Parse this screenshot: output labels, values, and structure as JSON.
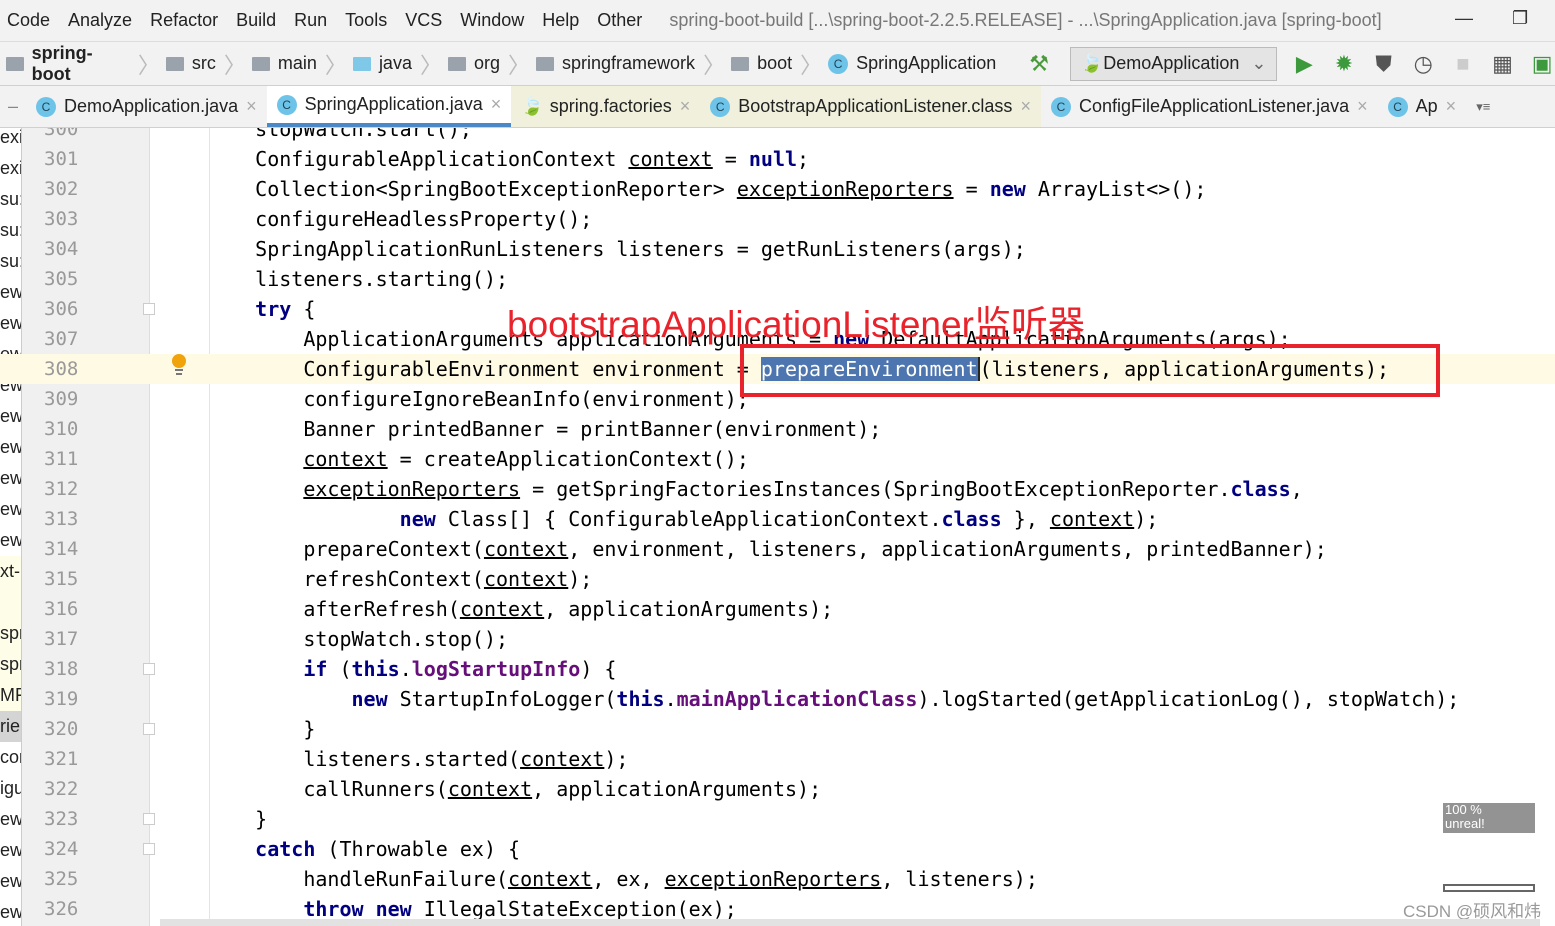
{
  "menu": [
    "Code",
    "Analyze",
    "Refactor",
    "Build",
    "Run",
    "Tools",
    "VCS",
    "Window",
    "Help",
    "Other"
  ],
  "window_title": "spring-boot-build [...\\spring-boot-2.2.5.RELEASE] - ...\\SpringApplication.java [spring-boot]",
  "window_buttons": {
    "minimize": "—",
    "restore": "❐"
  },
  "breadcrumb": [
    "spring-boot",
    "src",
    "main",
    "java",
    "org",
    "springframework",
    "boot",
    "SpringApplication"
  ],
  "run_config": "DemoApplication",
  "tabs": [
    {
      "label": "DemoApplication.java",
      "state": "normal"
    },
    {
      "label": "SpringApplication.java",
      "state": "active"
    },
    {
      "label": "spring.factories",
      "state": "yellow"
    },
    {
      "label": "BootstrapApplicationListener.class",
      "state": "yellow"
    },
    {
      "label": "ConfigFileApplicationListener.java",
      "state": "normal"
    },
    {
      "label": "Ap",
      "state": "normal"
    }
  ],
  "left_panel": [
    "exi",
    "exi",
    "su:",
    "su:",
    "su:",
    "ewo",
    "ewo",
    "ewo",
    "ewo",
    "ewo",
    "ewo",
    "ewo",
    "ewo",
    "ewo",
    "xt-",
    "",
    "spri",
    "spri",
    "MF",
    "rie",
    "cor",
    "igu",
    "ewo",
    "ewo",
    "ewo",
    "ewo",
    "ewo"
  ],
  "code": [
    {
      "n": "300",
      "t": [
        [
          "    stopWatch.start();",
          ""
        ]
      ]
    },
    {
      "n": "301",
      "t": [
        [
          "    ConfigurableApplicationContext ",
          ""
        ],
        [
          "context",
          "u"
        ],
        [
          " = ",
          ""
        ],
        [
          "null",
          "kw"
        ],
        [
          ";",
          ""
        ]
      ]
    },
    {
      "n": "302",
      "t": [
        [
          "    Collection<SpringBootExceptionReporter> ",
          ""
        ],
        [
          "exceptionReporters",
          "u"
        ],
        [
          " = ",
          ""
        ],
        [
          "new",
          "kw"
        ],
        [
          " ArrayList<>();",
          ""
        ]
      ]
    },
    {
      "n": "303",
      "t": [
        [
          "    configureHeadlessProperty();",
          ""
        ]
      ]
    },
    {
      "n": "304",
      "t": [
        [
          "    SpringApplicationRunListeners listeners = getRunListeners(args);",
          ""
        ]
      ]
    },
    {
      "n": "305",
      "t": [
        [
          "    listeners.starting();",
          ""
        ]
      ]
    },
    {
      "n": "306",
      "t": [
        [
          "    ",
          ""
        ],
        [
          "try",
          "kw"
        ],
        [
          " {",
          ""
        ]
      ]
    },
    {
      "n": "307",
      "t": [
        [
          "        ApplicationArguments applicationArguments = ",
          ""
        ],
        [
          "new",
          "kw"
        ],
        [
          " DefaultApplicationArguments(args);",
          ""
        ]
      ]
    },
    {
      "n": "308",
      "t": [
        [
          "        ConfigurableEnvironment environment = ",
          ""
        ],
        [
          "prepareEnvironment",
          "sel"
        ],
        [
          "(listeners, applicationArguments);",
          ""
        ]
      ]
    },
    {
      "n": "309",
      "t": [
        [
          "        configureIgnoreBeanInfo(environment);",
          ""
        ]
      ]
    },
    {
      "n": "310",
      "t": [
        [
          "        Banner printedBanner = printBanner(environment);",
          ""
        ]
      ]
    },
    {
      "n": "311",
      "t": [
        [
          "        ",
          ""
        ],
        [
          "context",
          "u"
        ],
        [
          " = createApplicationContext();",
          ""
        ]
      ]
    },
    {
      "n": "312",
      "t": [
        [
          "        ",
          ""
        ],
        [
          "exceptionReporters",
          "u"
        ],
        [
          " = getSpringFactoriesInstances(SpringBootExceptionReporter.",
          ""
        ],
        [
          "class",
          "kw"
        ],
        [
          ",",
          ""
        ]
      ]
    },
    {
      "n": "313",
      "t": [
        [
          "                ",
          ""
        ],
        [
          "new",
          "kw"
        ],
        [
          " Class[] { ConfigurableApplicationContext.",
          ""
        ],
        [
          "class",
          "kw"
        ],
        [
          " }, ",
          ""
        ],
        [
          "context",
          "u"
        ],
        [
          ");",
          ""
        ]
      ]
    },
    {
      "n": "314",
      "t": [
        [
          "        prepareContext(",
          ""
        ],
        [
          "context",
          "u"
        ],
        [
          ", environment, listeners, applicationArguments, printedBanner);",
          ""
        ]
      ]
    },
    {
      "n": "315",
      "t": [
        [
          "        refreshContext(",
          ""
        ],
        [
          "context",
          "u"
        ],
        [
          ");",
          ""
        ]
      ]
    },
    {
      "n": "316",
      "t": [
        [
          "        afterRefresh(",
          ""
        ],
        [
          "context",
          "u"
        ],
        [
          ", applicationArguments);",
          ""
        ]
      ]
    },
    {
      "n": "317",
      "t": [
        [
          "        stopWatch.stop();",
          ""
        ]
      ]
    },
    {
      "n": "318",
      "t": [
        [
          "        ",
          ""
        ],
        [
          "if",
          "kw"
        ],
        [
          " (",
          ""
        ],
        [
          "this",
          "kw"
        ],
        [
          ".",
          ""
        ],
        [
          "logStartupInfo",
          "fld"
        ],
        [
          ") {",
          ""
        ]
      ]
    },
    {
      "n": "319",
      "t": [
        [
          "            ",
          ""
        ],
        [
          "new",
          "kw"
        ],
        [
          " StartupInfoLogger(",
          ""
        ],
        [
          "this",
          "kw"
        ],
        [
          ".",
          ""
        ],
        [
          "mainApplicationClass",
          "fld"
        ],
        [
          ").logStarted(getApplicationLog(), stopWatch);",
          ""
        ]
      ]
    },
    {
      "n": "320",
      "t": [
        [
          "        }",
          ""
        ]
      ]
    },
    {
      "n": "321",
      "t": [
        [
          "        listeners.started(",
          ""
        ],
        [
          "context",
          "u"
        ],
        [
          ");",
          ""
        ]
      ]
    },
    {
      "n": "322",
      "t": [
        [
          "        callRunners(",
          ""
        ],
        [
          "context",
          "u"
        ],
        [
          ", applicationArguments);",
          ""
        ]
      ]
    },
    {
      "n": "323",
      "t": [
        [
          "    }",
          ""
        ]
      ]
    },
    {
      "n": "324",
      "t": [
        [
          "    ",
          ""
        ],
        [
          "catch",
          "kw"
        ],
        [
          " (Throwable ex) {",
          ""
        ]
      ]
    },
    {
      "n": "325",
      "t": [
        [
          "        handleRunFailure(",
          ""
        ],
        [
          "context",
          "u"
        ],
        [
          ", ex, ",
          ""
        ],
        [
          "exceptionReporters",
          "u"
        ],
        [
          ", listeners);",
          ""
        ]
      ]
    },
    {
      "n": "326",
      "t": [
        [
          "        ",
          ""
        ],
        [
          "throw",
          "kw"
        ],
        [
          " ",
          ""
        ],
        [
          "new",
          "kw"
        ],
        [
          " IllegalStateException(ex);",
          ""
        ]
      ]
    }
  ],
  "current_line": "308",
  "annotation": "bootstrapApplicationListener监听器",
  "annotation_color": "#e8232b",
  "zoom_overlay": {
    "line1": "100 %",
    "line2": "unreal!"
  },
  "watermark": "CSDN @硕风和炜"
}
